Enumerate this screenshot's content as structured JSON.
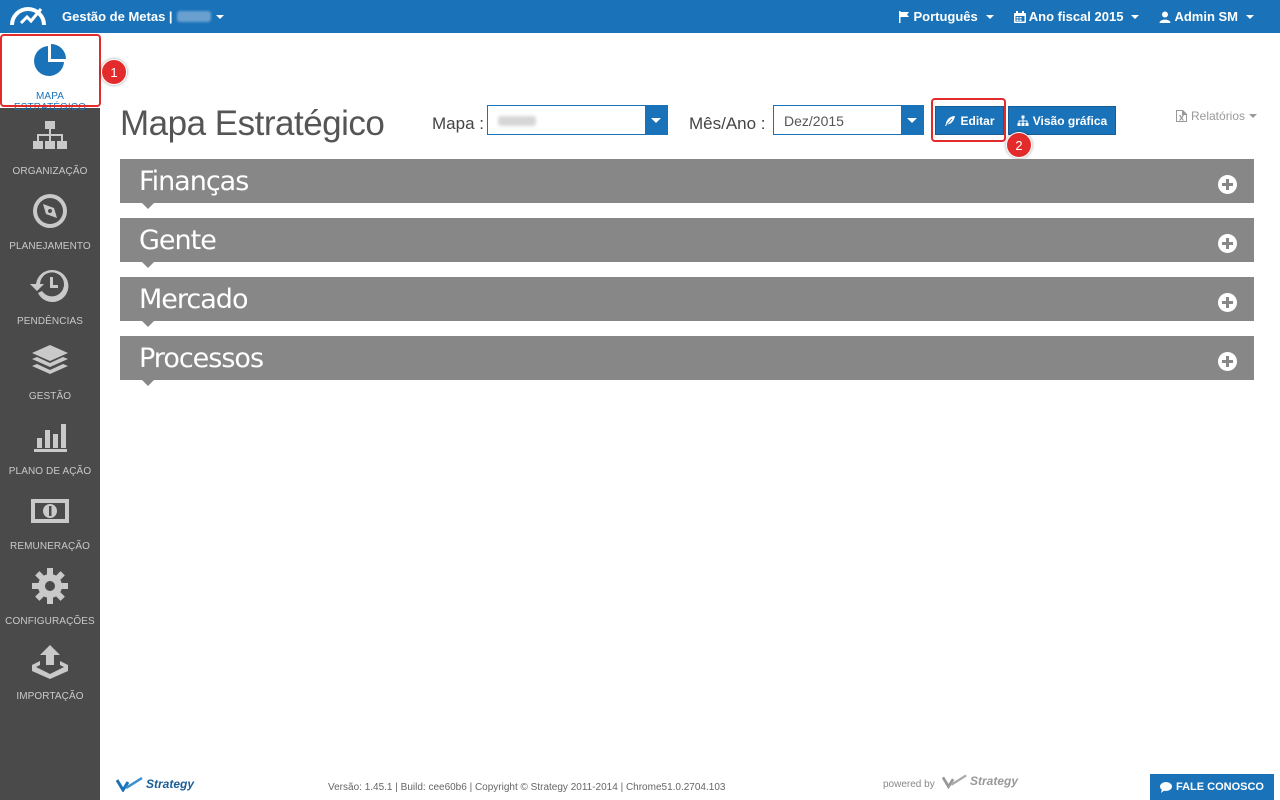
{
  "topbar": {
    "app_title": "Gestão de Metas |",
    "language": "Português",
    "fiscal_year": "Ano fiscal 2015",
    "user": "Admin SM"
  },
  "sidebar": {
    "items": [
      {
        "label": "MAPA ESTRATÉGICO",
        "icon": "pie-chart-icon",
        "active": true
      },
      {
        "label": "ORGANIZAÇÃO",
        "icon": "org-chart-icon"
      },
      {
        "label": "PLANEJAMENTO",
        "icon": "compass-icon"
      },
      {
        "label": "PENDÊNCIAS",
        "icon": "history-icon"
      },
      {
        "label": "GESTÃO",
        "icon": "layers-icon"
      },
      {
        "label": "PLANO DE AÇÃO",
        "icon": "bar-chart-icon"
      },
      {
        "label": "REMUNERAÇÃO",
        "icon": "money-icon"
      },
      {
        "label": "CONFIGURAÇÕES",
        "icon": "gear-icon"
      },
      {
        "label": "IMPORTAÇÃO",
        "icon": "import-icon"
      }
    ]
  },
  "main": {
    "page_title": "Mapa Estratégico",
    "mapa_label": "Mapa :",
    "mes_ano_label": "Mês/Ano :",
    "mes_ano_value": "Dez/2015",
    "edit_button": "Editar",
    "visao_button": "Visão gráfica",
    "relatorios": "Relatórios",
    "panels": [
      "Finanças",
      "Gente",
      "Mercado",
      "Processos"
    ]
  },
  "annotations": {
    "badge1": "1",
    "badge2": "2"
  },
  "footer": {
    "brand": "Strategy",
    "version_text": "Versão: 1.45.1 | Build: cee60b6 | Copyright © Strategy 2011-2014 | Chrome51.0.2704.103",
    "powered_by": "powered by",
    "powered_brand": "Strategy",
    "fale_conosco": "FALE CONOSCO"
  },
  "colors": {
    "primary": "#1a73b9",
    "sidebar": "#4a4a4a",
    "panel": "#878787",
    "highlight": "#e32b2b"
  }
}
